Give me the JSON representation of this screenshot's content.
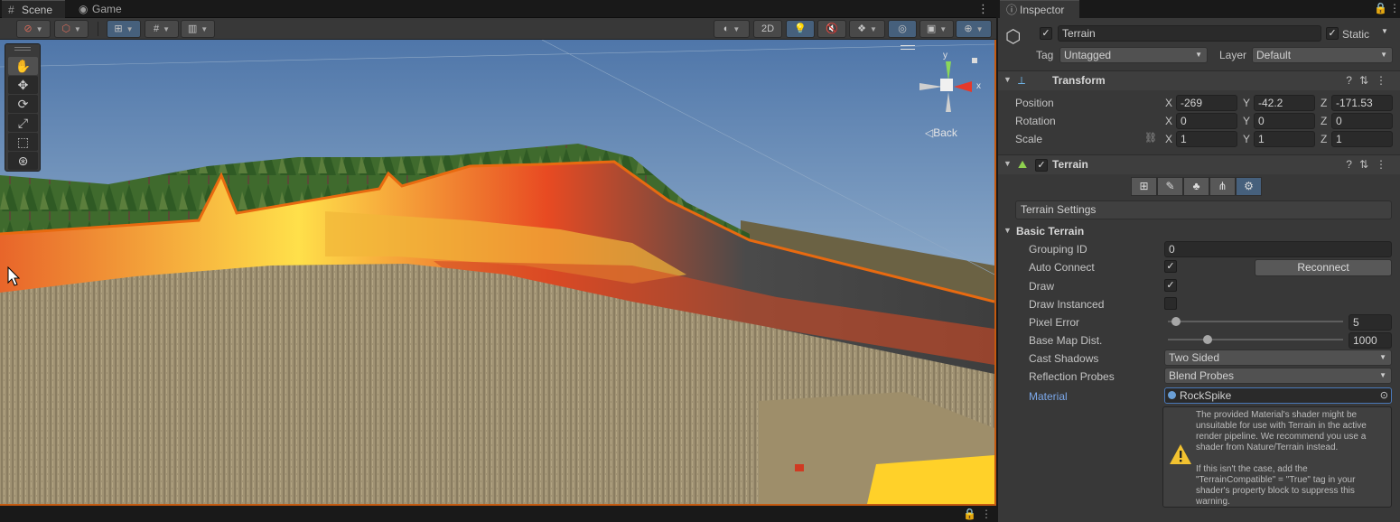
{
  "scene_panel": {
    "tabs": [
      {
        "label": "Scene",
        "icon": "hash-grid-icon"
      },
      {
        "label": "Game",
        "icon": "gamepad-icon"
      }
    ],
    "toolbar": {
      "view_2d_label": "2D"
    },
    "gizmo": {
      "back_label": "Back",
      "y_axis_label": "y",
      "x_axis_label": "x"
    }
  },
  "inspector": {
    "tab_label": "Inspector",
    "object": {
      "name": "Terrain",
      "static_label": "Static",
      "tag_label": "Tag",
      "tag_value": "Untagged",
      "layer_label": "Layer",
      "layer_value": "Default"
    },
    "transform": {
      "title": "Transform",
      "rows": [
        {
          "label": "Position",
          "x": "-269",
          "y": "-42.2",
          "z": "-171.53"
        },
        {
          "label": "Rotation",
          "x": "0",
          "y": "0",
          "z": "0"
        },
        {
          "label": "Scale",
          "x": "1",
          "y": "1",
          "z": "1"
        }
      ],
      "axis_x": "X",
      "axis_y": "Y",
      "axis_z": "Z"
    },
    "terrain": {
      "title": "Terrain",
      "settings_label": "Terrain Settings",
      "basic_title": "Basic Terrain",
      "grouping_id_label": "Grouping ID",
      "grouping_id_value": "0",
      "auto_connect_label": "Auto Connect",
      "reconnect_label": "Reconnect",
      "draw_label": "Draw",
      "draw_instanced_label": "Draw Instanced",
      "pixel_error_label": "Pixel Error",
      "pixel_error_value": "5",
      "pixel_error_level": 0.02,
      "base_map_label": "Base Map Dist.",
      "base_map_value": "1000",
      "base_map_level": 0.2,
      "cast_shadows_label": "Cast Shadows",
      "cast_shadows_value": "Two Sided",
      "reflection_label": "Reflection Probes",
      "reflection_value": "Blend Probes",
      "material_label": "Material",
      "material_value": "RockSpike",
      "warning_text": "The provided Material's shader might be unsuitable for use with Terrain in the active render pipeline. We recommend you use a shader from Nature/Terrain instead.\n\nIf this isn't the case, add the \"TerrainCompatible\" = \"True\" tag in your shader's property block to suppress this warning."
    }
  },
  "colors": {
    "accent_blue": "#46607c",
    "selection_orange": "#e86a10",
    "material_label_blue": "#7ba7e8"
  }
}
